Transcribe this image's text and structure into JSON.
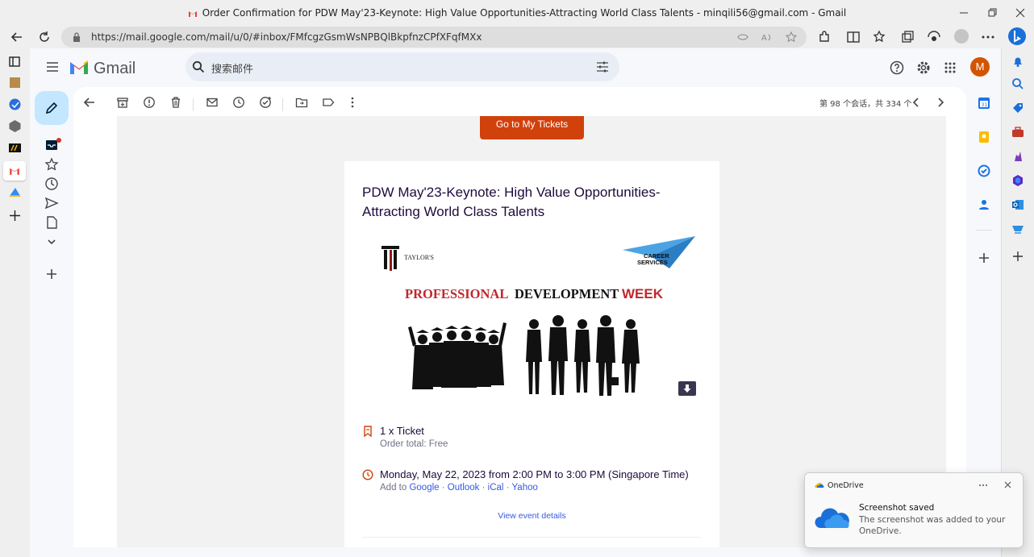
{
  "window": {
    "title": "Order Confirmation for PDW May'23-Keynote: High Value Opportunities-Attracting World Class Talents - minqili56@gmail.com - Gmail"
  },
  "browser": {
    "url": "https://mail.google.com/mail/u/0/#inbox/FMfcgzGsmWsNPBQlBkpfnzCPfXFqfMXx"
  },
  "gmail": {
    "logo_text": "Gmail",
    "search_placeholder": "搜索邮件",
    "avatar_letter": "M",
    "pagination": "第 98 个会话，共 334 个"
  },
  "email": {
    "tickets_button": "Go to My Tickets",
    "event_title": "PDW May'23-Keynote: High Value Opportunities-Attracting World Class Talents",
    "banner": {
      "brand_left": "TAYLOR'S",
      "brand_right_line1": "CAREER",
      "brand_right_line2": "SERVICES",
      "headline_word1": "PROFESSIONAL",
      "headline_word2": "DEVELOPMENT",
      "headline_word3": "WEEK"
    },
    "ticket_count": "1 x Ticket",
    "order_total": "Order total: Free",
    "datetime": "Monday, May 22, 2023 from 2:00 PM to 3:00 PM (Singapore Time)",
    "add_to_label": "Add to",
    "calendar_links": [
      "Google",
      "Outlook",
      "iCal",
      "Yahoo"
    ],
    "view_details": "View event details"
  },
  "toast": {
    "app_name": "OneDrive",
    "heading": "Screenshot saved",
    "body": "The screenshot was added to your OneDrive."
  },
  "colors": {
    "accent_orange": "#d1410c",
    "compose_bg": "#c2e7ff",
    "link_blue": "#3659e3",
    "avatar_bg": "#d35400"
  }
}
